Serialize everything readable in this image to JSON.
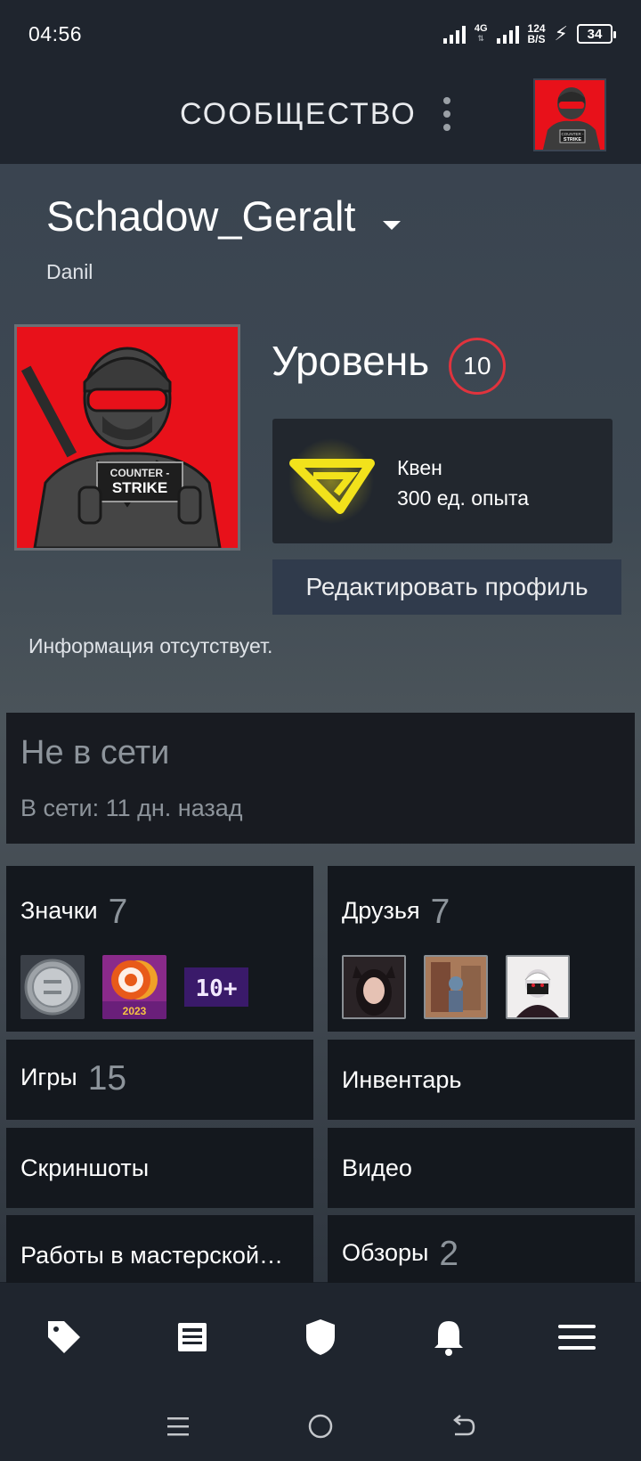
{
  "status_bar": {
    "time": "04:56",
    "network": "4G",
    "speed_value": "124",
    "speed_unit": "B/S",
    "battery": "34"
  },
  "header": {
    "title": "СООБЩЕСТВО"
  },
  "profile": {
    "username": "Schadow_Geralt",
    "real_name": "Danil",
    "avatar_text_top": "COUNTER -",
    "avatar_text_bottom": "STRIKE",
    "level_label": "Уровень",
    "level_value": "10",
    "badge_name": "Квен",
    "badge_xp": "300 ед. опыта",
    "edit_button": "Редактировать профиль",
    "summary": "Информация отсутствует."
  },
  "status": {
    "state": "Не в сети",
    "last_online": "В сети: 11 дн. назад"
  },
  "tiles": {
    "badges_label": "Значки",
    "badges_count": "7",
    "badge_thumb_3_text": "10+",
    "badge_thumb_2_year": "2023",
    "friends_label": "Друзья",
    "friends_count": "7",
    "games_label": "Игры",
    "games_count": "15",
    "inventory_label": "Инвентарь",
    "screenshots_label": "Скриншоты",
    "videos_label": "Видео",
    "workshop_label": "Работы в мастерской…",
    "reviews_label": "Обзоры",
    "reviews_count": "2"
  },
  "icons": {
    "bottom_nav": [
      "tag-icon",
      "news-icon",
      "shield-icon",
      "bell-icon",
      "menu-icon"
    ],
    "system_nav": [
      "recent-apps-icon",
      "home-icon",
      "back-icon"
    ]
  },
  "colors": {
    "background": "#1b2028",
    "header": "#1f252e",
    "tile": "#14181e",
    "level_ring": "#e0333d",
    "edit_button": "#303b4c",
    "muted_text": "#8d949b",
    "badge_yellow": "#f2e21b"
  }
}
